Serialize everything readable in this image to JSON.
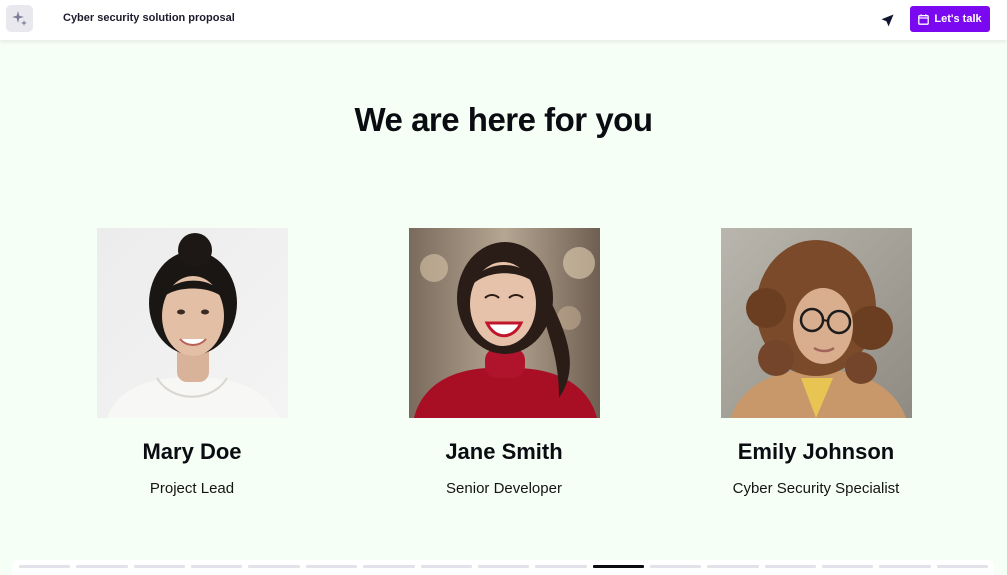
{
  "header": {
    "logo_icon": "sparkles-icon",
    "title": "Cyber security solution proposal",
    "send_icon": "send-icon",
    "cta_label": "Let's talk",
    "cta_icon": "calendar-icon",
    "accent": "#7a08f0"
  },
  "main": {
    "headline": "We are here for you",
    "team": [
      {
        "name": "Mary Doe",
        "role": "Project Lead"
      },
      {
        "name": "Jane Smith",
        "role": "Senior Developer"
      },
      {
        "name": "Emily Johnson",
        "role": "Cyber Security Specialist"
      }
    ]
  },
  "progress": {
    "total_slides": 17,
    "current_slide": 11
  }
}
